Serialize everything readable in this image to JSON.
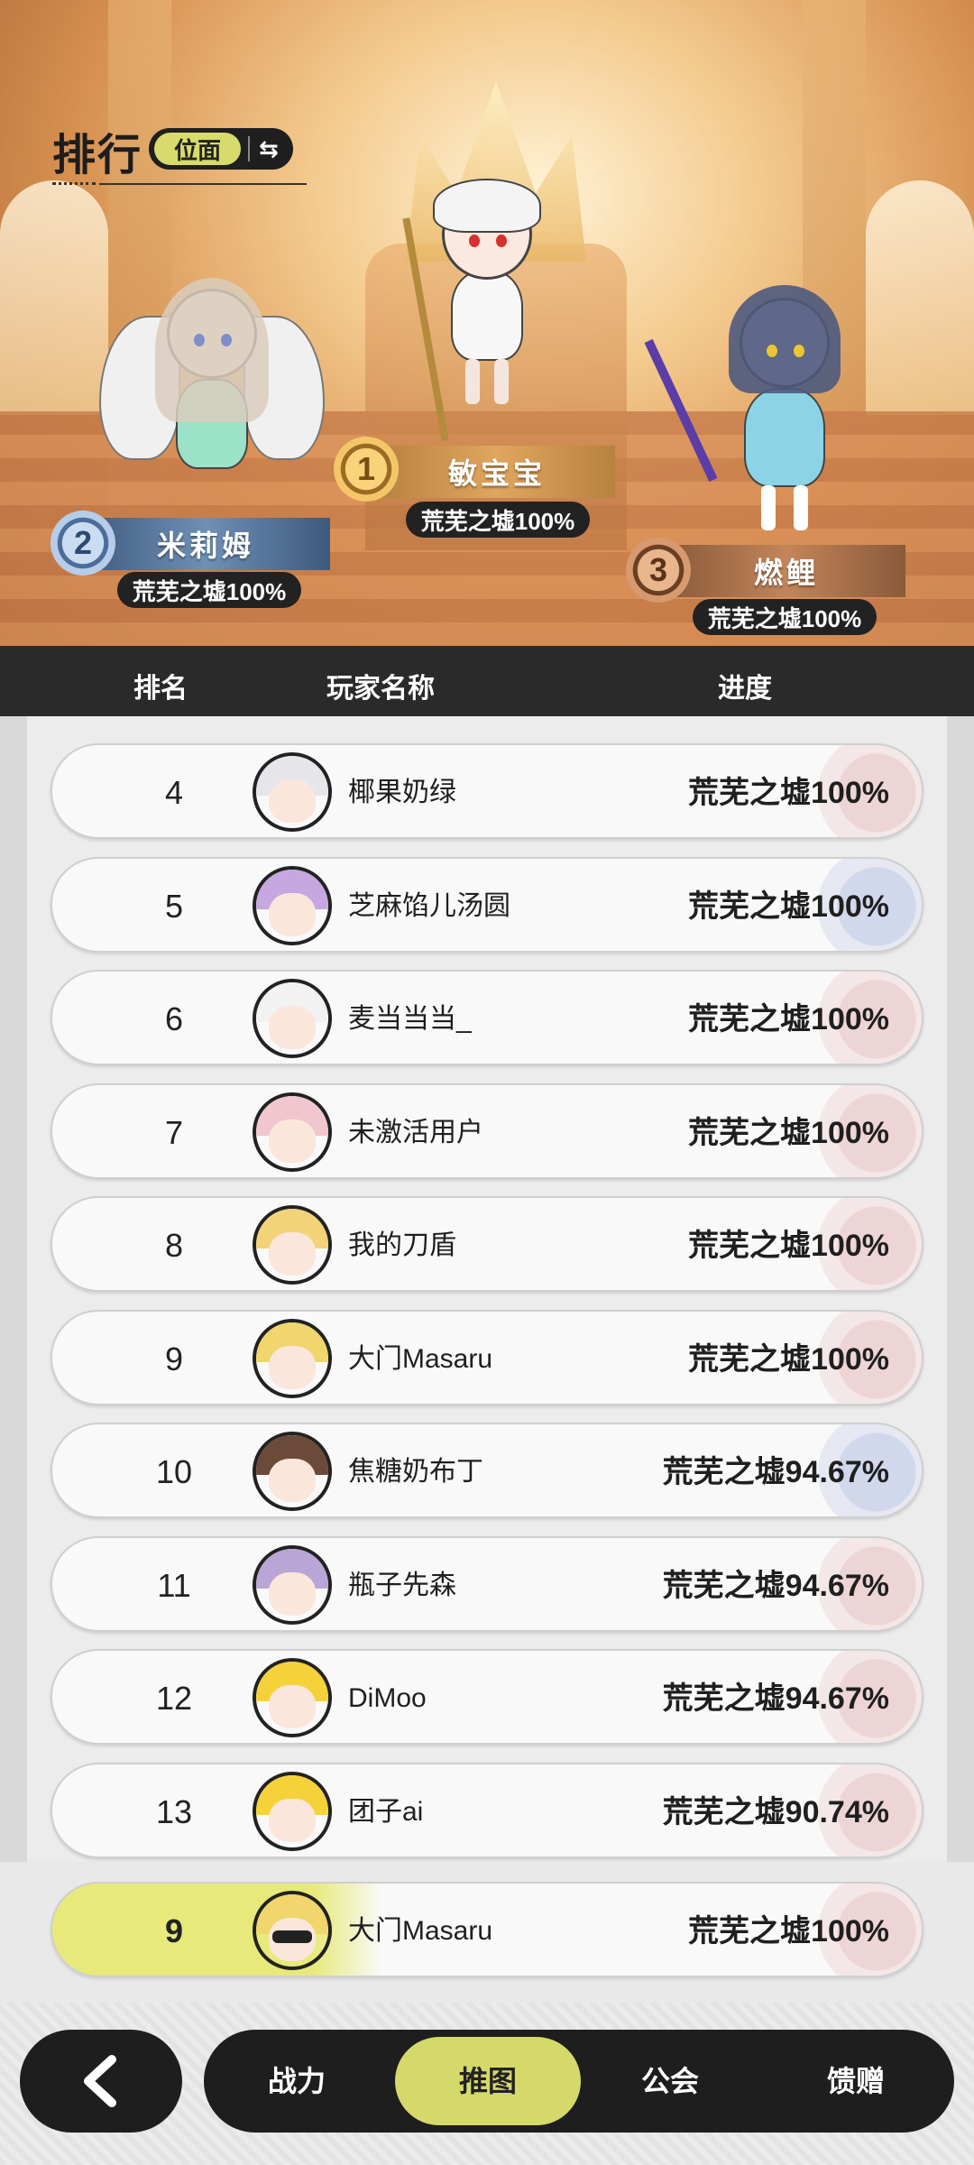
{
  "header": {
    "title": "排行",
    "scope_label": "位面",
    "swap_icon": "swap-arrows-icon"
  },
  "podium": [
    {
      "rank": "1",
      "name": "敏宝宝",
      "progress": "荒芜之墟100%"
    },
    {
      "rank": "2",
      "name": "米莉姆",
      "progress": "荒芜之墟100%"
    },
    {
      "rank": "3",
      "name": "燃鲤",
      "progress": "荒芜之墟100%"
    }
  ],
  "table": {
    "columns": {
      "rank": "排名",
      "name": "玩家名称",
      "progress": "进度"
    },
    "rows": [
      {
        "rank": "4",
        "name": "椰果奶绿",
        "progress": "荒芜之墟100%",
        "hair": "#e6e6ea",
        "deco": "red"
      },
      {
        "rank": "5",
        "name": "芝麻馅儿汤圆",
        "progress": "荒芜之墟100%",
        "hair": "#c7a7e0",
        "deco": "blue"
      },
      {
        "rank": "6",
        "name": "麦当当当_",
        "progress": "荒芜之墟100%",
        "hair": "#f2f2f2",
        "deco": "red"
      },
      {
        "rank": "7",
        "name": "未激活用户",
        "progress": "荒芜之墟100%",
        "hair": "#f1c7cf",
        "deco": "red"
      },
      {
        "rank": "8",
        "name": "我的刀盾",
        "progress": "荒芜之墟100%",
        "hair": "#f3d37a",
        "deco": "red"
      },
      {
        "rank": "9",
        "name": "大门Masaru",
        "progress": "荒芜之墟100%",
        "hair": "#f0d66c",
        "deco": "red"
      },
      {
        "rank": "10",
        "name": "焦糖奶布丁",
        "progress": "荒芜之墟94.67%",
        "hair": "#6b4a3a",
        "deco": "blue"
      },
      {
        "rank": "11",
        "name": "瓶子先森",
        "progress": "荒芜之墟94.67%",
        "hair": "#b9a6d6",
        "deco": "red"
      },
      {
        "rank": "12",
        "name": "DiMoo",
        "progress": "荒芜之墟94.67%",
        "hair": "#f6d23a",
        "deco": "red"
      },
      {
        "rank": "13",
        "name": "团子ai",
        "progress": "荒芜之墟90.74%",
        "hair": "#f6d23a",
        "deco": "red"
      }
    ]
  },
  "my_rank": {
    "rank": "9",
    "name": "大门Masaru",
    "progress": "荒芜之墟100%"
  },
  "bottom_nav": {
    "back_icon": "chevron-left-icon",
    "tabs": [
      {
        "label": "战力",
        "active": false
      },
      {
        "label": "推图",
        "active": true
      },
      {
        "label": "公会",
        "active": false
      },
      {
        "label": "馈赠",
        "active": false
      }
    ]
  },
  "colors": {
    "accent": "#d5d96a",
    "dark": "#1e1e1e",
    "row_bg": "#f9f9f9"
  }
}
